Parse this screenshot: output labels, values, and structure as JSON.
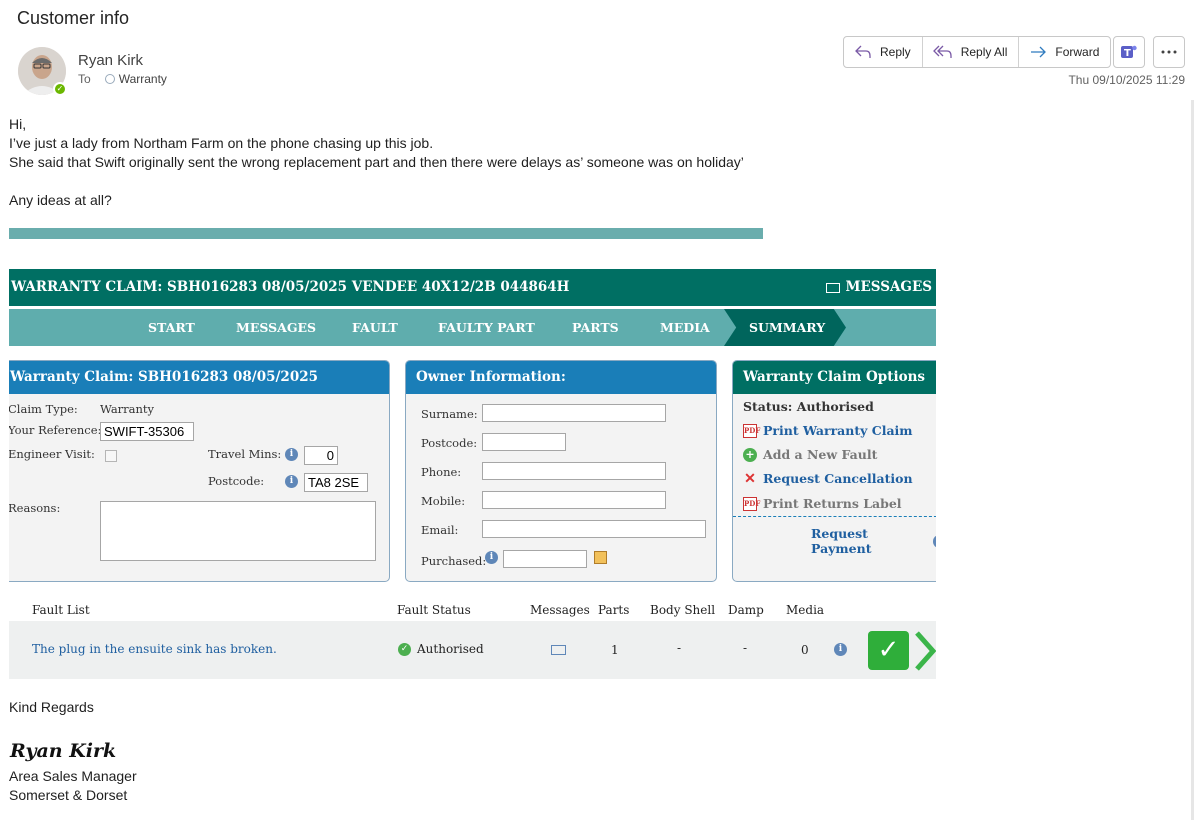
{
  "email": {
    "subject": "Customer info",
    "sender": "Ryan Kirk",
    "to_label": "To",
    "recipient": "Warranty",
    "date": "Thu 09/10/2025 11:29",
    "actions": {
      "reply": "Reply",
      "reply_all": "Reply All",
      "forward": "Forward"
    },
    "body_lines": [
      "Hi,",
      "I’ve just a lady from Northam Farm on the phone chasing up this job.",
      "She said that Swift originally sent the wrong replacement part and then there were delays as’ someone was on holiday’",
      "",
      "Any ideas at all?"
    ],
    "closing": "Kind Regards",
    "signature_name": "Ryan Kirk",
    "title": "Area Sales Manager",
    "region": "Somerset & Dorset"
  },
  "claim": {
    "header": "WARRANTY CLAIM: SBH016283 08/05/2025 VENDEE 40X12/2B 044864H",
    "messages_link": "MESSAGES",
    "nav": [
      "START",
      "MESSAGES",
      "FAULT",
      "FAULTY PART",
      "PARTS",
      "MEDIA",
      "SUMMARY"
    ],
    "panel1": {
      "title": "Warranty Claim: SBH016283 08/05/2025",
      "claim_type_label": "Claim Type:",
      "claim_type_value": "Warranty",
      "reference_label": "Your Reference:",
      "reference_value": "SWIFT-35306",
      "engineer_label": "Engineer Visit:",
      "travel_label": "Travel Mins:",
      "travel_value": "0",
      "postcode_label": "Postcode:",
      "postcode_value": "TA8 2SE",
      "reasons_label": "Reasons:"
    },
    "panel2": {
      "title": "Owner Information:",
      "surname": "Surname:",
      "postcode": "Postcode:",
      "phone": "Phone:",
      "mobile": "Mobile:",
      "email": "Email:",
      "purchased": "Purchased:"
    },
    "panel3": {
      "title": "Warranty Claim Options",
      "status": "Status: Authorised",
      "print_claim": "Print Warranty Claim",
      "add_fault": "Add a New Fault",
      "request_cancel": "Request Cancellation",
      "print_returns": "Print Returns Label",
      "request_payment": "Request Payment"
    },
    "fault_headers": [
      "Fault List",
      "Fault Status",
      "Messages",
      "Parts",
      "Body Shell",
      "Damp",
      "Media"
    ],
    "fault_row": {
      "description": "The plug in the ensuite sink has broken.",
      "status": "Authorised",
      "parts": "1",
      "body_shell": "-",
      "damp": "-",
      "media": "0"
    }
  },
  "colors": {
    "teal_dark": "#006f63",
    "teal_light": "#5fadad",
    "panel_blue": "#1a7eb8",
    "authorised_green": "#4caf50"
  }
}
